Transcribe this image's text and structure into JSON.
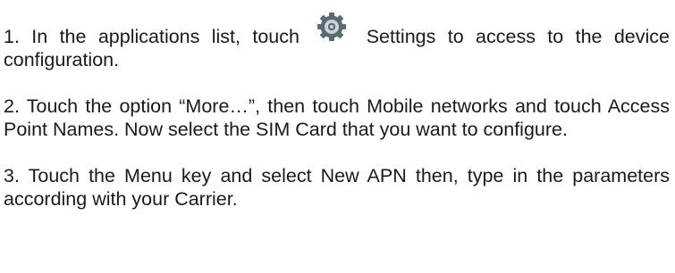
{
  "document": {
    "step1": {
      "before_icon": "1. In the applications list, touch",
      "icon": "settings-gear-icon",
      "after_icon": "Settings to access to the device configuration."
    },
    "step2": "2. Touch the option “More…”, then touch Mobile networks and touch Access Point Names. Now select the SIM Card that you want to configure.",
    "step3": "3. Touch the Menu key and select New APN then, type in the parameters according with your Carrier.",
    "colors": {
      "text": "#1a1a1a",
      "icon_outer": "#5a6b73",
      "icon_inner": "#c9d3d8"
    }
  }
}
